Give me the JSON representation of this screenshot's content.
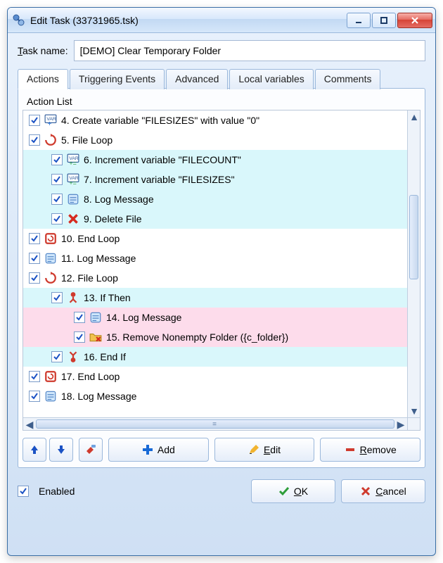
{
  "window": {
    "title": "Edit Task (33731965.tsk)"
  },
  "task_name": {
    "label": "Task name:",
    "value": "[DEMO] Clear Temporary Folder"
  },
  "tabs": [
    "Actions",
    "Triggering Events",
    "Advanced",
    "Local variables",
    "Comments"
  ],
  "active_tab": 0,
  "list_header": "Action List",
  "actions": [
    {
      "indent": 0,
      "icon": "var-plus",
      "bg": "white",
      "text": "4. Create variable \"FILESIZES\" with value \"0\""
    },
    {
      "indent": 0,
      "icon": "loop",
      "bg": "white",
      "text": "5. File Loop"
    },
    {
      "indent": 1,
      "icon": "var-inc",
      "bg": "cyan",
      "text": "6. Increment variable \"FILECOUNT\""
    },
    {
      "indent": 1,
      "icon": "var-inc",
      "bg": "cyan",
      "text": "7. Increment variable \"FILESIZES\""
    },
    {
      "indent": 1,
      "icon": "log",
      "bg": "cyan",
      "text": "8. Log Message"
    },
    {
      "indent": 1,
      "icon": "delete",
      "bg": "cyan",
      "text": "9. Delete File"
    },
    {
      "indent": 0,
      "icon": "end-loop",
      "bg": "white",
      "text": "10. End Loop"
    },
    {
      "indent": 0,
      "icon": "log",
      "bg": "white",
      "text": "11. Log Message"
    },
    {
      "indent": 0,
      "icon": "loop",
      "bg": "white",
      "text": "12. File Loop"
    },
    {
      "indent": 1,
      "icon": "if",
      "bg": "cyan",
      "text": "13. If Then"
    },
    {
      "indent": 2,
      "icon": "log",
      "bg": "pink",
      "text": "14. Log Message"
    },
    {
      "indent": 2,
      "icon": "folder-del",
      "bg": "pink",
      "text": "15. Remove Nonempty Folder  ({c_folder})"
    },
    {
      "indent": 1,
      "icon": "end-if",
      "bg": "cyan",
      "text": "16. End If"
    },
    {
      "indent": 0,
      "icon": "end-loop",
      "bg": "white",
      "text": "17. End Loop"
    },
    {
      "indent": 0,
      "icon": "log",
      "bg": "white",
      "text": "18. Log Message"
    }
  ],
  "buttons": {
    "add": "Add",
    "edit": "Edit",
    "remove": "Remove",
    "ok": "OK",
    "cancel": "Cancel"
  },
  "enabled_label": "Enabled"
}
